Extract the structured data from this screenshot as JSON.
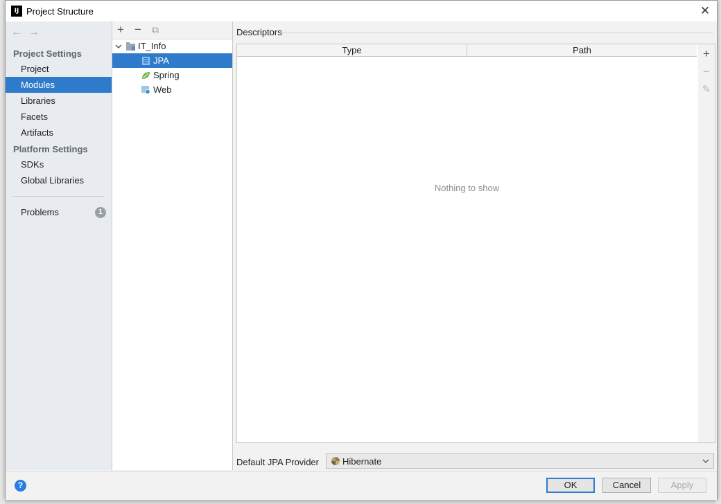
{
  "window": {
    "title": "Project Structure",
    "app_icon_text": "IJ",
    "close_glyph": "✕"
  },
  "nav": {
    "back": "←",
    "forward": "→"
  },
  "sidebar": {
    "project_settings_header": "Project Settings",
    "project_items": [
      "Project",
      "Modules",
      "Libraries",
      "Facets",
      "Artifacts"
    ],
    "platform_settings_header": "Platform Settings",
    "platform_items": [
      "SDKs",
      "Global Libraries"
    ],
    "problems_label": "Problems",
    "problems_count": "1",
    "selected": "Modules"
  },
  "module_toolbar": {
    "add": "+",
    "remove": "−",
    "copy": "⧉"
  },
  "module_tree": {
    "root": "IT_Info",
    "children": [
      "JPA",
      "Spring",
      "Web"
    ],
    "selected": "JPA"
  },
  "descriptors": {
    "label": "Descriptors",
    "columns": [
      "Type",
      "Path"
    ],
    "empty_text": "Nothing to show",
    "tools": {
      "add": "+",
      "remove": "−",
      "edit": "✎"
    }
  },
  "jpa_provider": {
    "label": "Default JPA Provider",
    "value": "Hibernate"
  },
  "footer": {
    "help": "?",
    "ok": "OK",
    "cancel": "Cancel",
    "apply": "Apply"
  },
  "colors": {
    "selection": "#2f7bcb",
    "help": "#2a7de1",
    "sidebar_bg": "#e8ebf0"
  }
}
